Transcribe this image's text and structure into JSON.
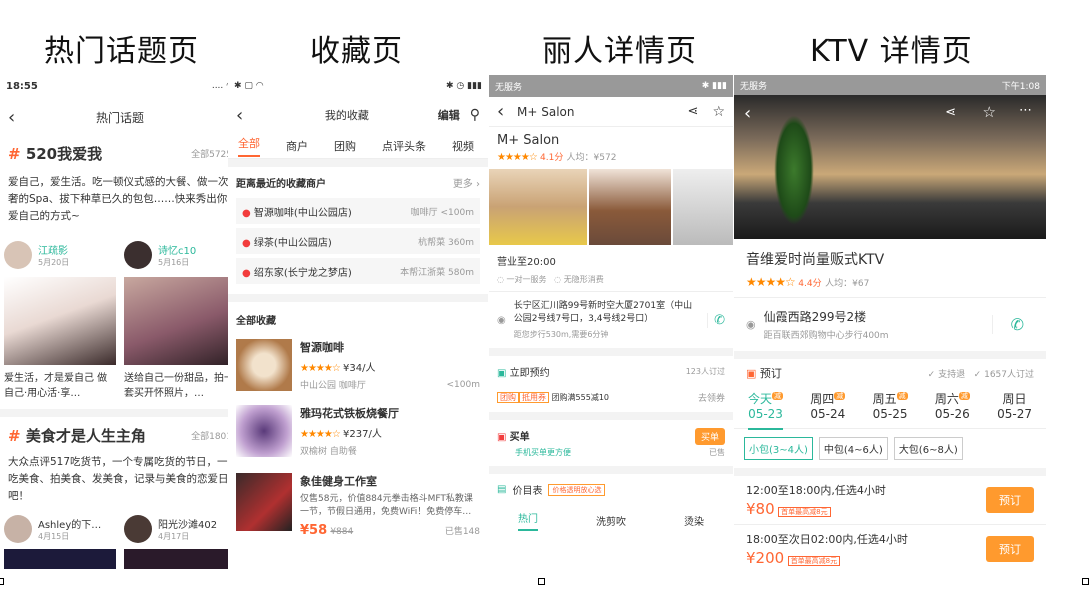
{
  "headings": [
    "热门话题页",
    "收藏页",
    "丽人详情页",
    "KTV 详情页"
  ],
  "p1": {
    "time": "18:55",
    "signal": "....",
    "title": "热门话题",
    "topic1": {
      "title": "520我爱我",
      "count": "全部5725",
      "desc": "爱自己，爱生活。吃一顿仪式感的大餐、做一次奢的Spa、拔下种草已久的包包……快来秀出你爱自己的方式~"
    },
    "users1": [
      {
        "name": "江疏影",
        "date": "5月20日",
        "caption": "爱生活，才是爱自己 做自己·用心活·享…"
      },
      {
        "name": "诗忆c10",
        "date": "5月16日",
        "caption": "送给自己一份甜品，拍一套买开怀照片，…"
      }
    ],
    "topic2": {
      "title": "美食才是人生主角",
      "count": "全部1801",
      "desc": "大众点评517吃货节，一个专属吃货的节日，一吃美食、拍美食、发美食，记录与美食的恋爱日吧！"
    },
    "users2": [
      {
        "name": "Ashley的下…",
        "date": "4月15日"
      },
      {
        "name": "阳光沙滩402",
        "date": "4月17日"
      }
    ]
  },
  "p2": {
    "title": "我的收藏",
    "edit": "编辑",
    "tabs": [
      "全部",
      "商户",
      "团购",
      "点评头条",
      "视频"
    ],
    "nearby_title": "距离最近的收藏商户",
    "more": "更多",
    "nearby": [
      {
        "name": "智源咖啡(中山公园店)",
        "cat": "咖啡厅",
        "dist": "<100m"
      },
      {
        "name": "绿茶(中山公园店)",
        "cat": "杭帮菜",
        "dist": "360m"
      },
      {
        "name": "绍东家(长宁龙之梦店)",
        "cat": "本帮江浙菜",
        "dist": "580m"
      }
    ],
    "all_title": "全部收藏",
    "items": [
      {
        "name": "智源咖啡",
        "price": "¥34/人",
        "meta": "中山公园 咖啡厅",
        "dist": "<100m"
      },
      {
        "name": "雅玛花式铁板烧餐厅",
        "price": "¥237/人",
        "meta": "双榆树 自助餐",
        "dist": ""
      },
      {
        "name": "象佳健身工作室",
        "desc": "仅售58元，价值884元拳击格斗MFT私教课一节，节假日通用，免费WiFi！免费停车…",
        "price": "¥58",
        "orig": "¥884",
        "sold": "已售148"
      }
    ]
  },
  "p3": {
    "status_left": "无服务",
    "title": "M+ Salon",
    "name": "M+ Salon",
    "score": "4.1分",
    "avg": "人均：¥572",
    "hours": "营业至20:00",
    "services": [
      "一对一服务",
      "无隐形消费"
    ],
    "address": "长宁区汇川路99号新时空大厦2701室（中山公园2号线7号口，3,4号线2号口）",
    "distance": "距您步行530m,需要6分钟",
    "book": "立即预约",
    "book_count": "123人订过",
    "tags": [
      "团购",
      "抵用券"
    ],
    "deal": "团购满555减10",
    "deal_link": "去领券",
    "buy_title": "买单",
    "buy_sub": "手机买单更方便",
    "buy_btn": "买单",
    "buy_sold": "已售",
    "price_title": "价目表",
    "price_tag": "价格透明放心选",
    "price_tabs": [
      "热门",
      "洗剪吹",
      "烫染"
    ]
  },
  "p4": {
    "status_left": "无服务",
    "time": "下午1:08",
    "name": "音维爱时尚量贩式KTV",
    "score": "4.4分",
    "avg": "人均：¥67",
    "address": "仙霞西路299号2楼",
    "distance": "距百联西郊购物中心步行400m",
    "book": "预订",
    "support": "支持退",
    "book_count": "1657人订过",
    "days": [
      {
        "label": "今天",
        "date": "05-23",
        "badge": "减"
      },
      {
        "label": "周四",
        "date": "05-24",
        "badge": "减"
      },
      {
        "label": "周五",
        "date": "05-25",
        "badge": "减"
      },
      {
        "label": "周六",
        "date": "05-26",
        "badge": "减"
      },
      {
        "label": "周日",
        "date": "05-27",
        "badge": ""
      }
    ],
    "rooms": [
      "小包(3~4人)",
      "中包(4~6人)",
      "大包(6~8人)"
    ],
    "slots": [
      {
        "time": "12:00至18:00内,任选4小时",
        "price": "¥80",
        "tag": "首单最高减8元",
        "btn": "预订"
      },
      {
        "time": "18:00至次日02:00内,任选4小时",
        "price": "¥200",
        "tag": "首单最高减8元",
        "btn": "预订"
      }
    ]
  }
}
